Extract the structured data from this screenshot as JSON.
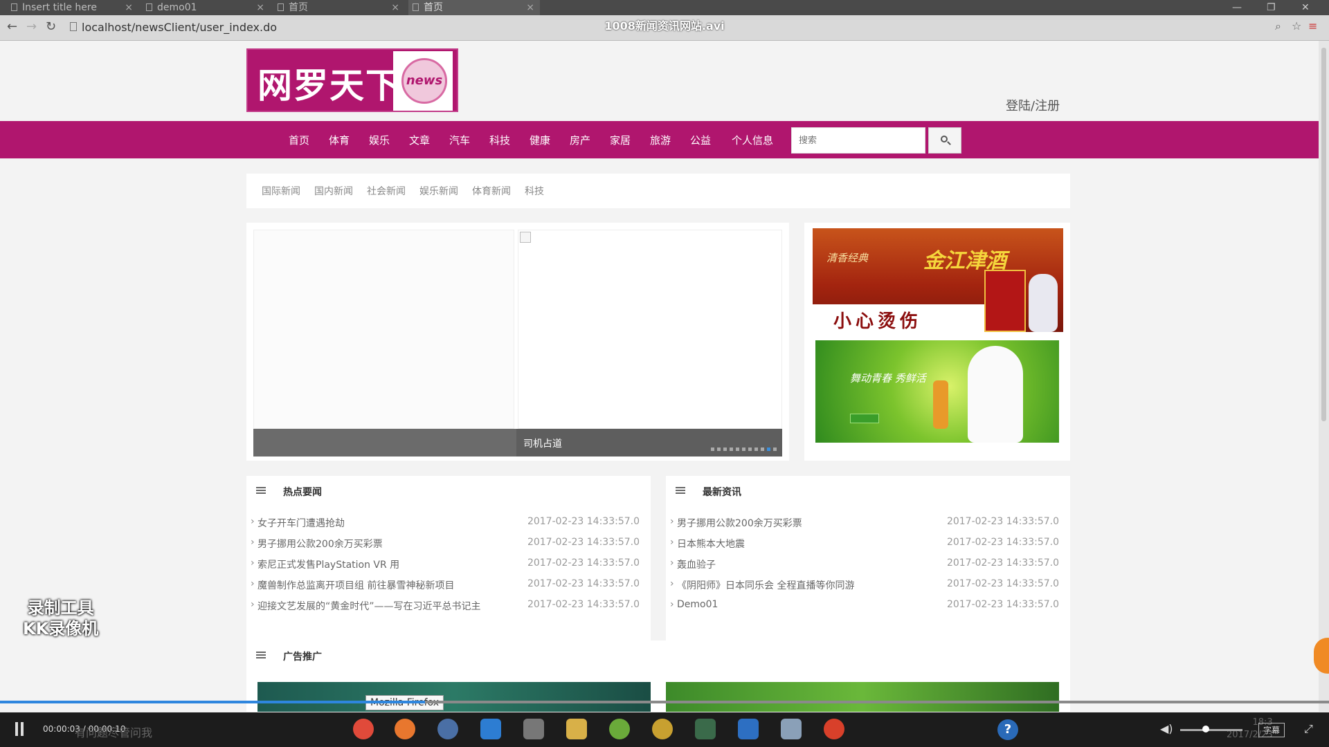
{
  "browser": {
    "tabs": [
      {
        "label": "Insert title here"
      },
      {
        "label": "demo01"
      },
      {
        "label": "首页"
      },
      {
        "label": "首页"
      }
    ],
    "url": "localhost/newsClient/user_index.do",
    "video_title": "1008新闻资讯网站.avi"
  },
  "site": {
    "logo_text": "网罗天下",
    "logo_badge": "news",
    "login_link": "登陆/注册",
    "nav": [
      "首页",
      "体育",
      "娱乐",
      "文章",
      "汽车",
      "科技",
      "健康",
      "房产",
      "家居",
      "旅游",
      "公益",
      "个人信息"
    ],
    "search": {
      "placeholder": "搜索"
    },
    "subnav": [
      "国际新闻",
      "国内新闻",
      "社会新闻",
      "娱乐新闻",
      "体育新闻",
      "科技"
    ],
    "carousel": {
      "caption": "司机占道",
      "dot_count": 11
    },
    "ads": {
      "ad1": {
        "slogan": "清香经典",
        "brand": "金江津酒",
        "banner": "小心烫伤"
      },
      "ad2": {
        "slogan": "舞动青春 秀鲜活"
      }
    },
    "hot_news": {
      "title": "热点要闻",
      "items": [
        {
          "title": "女子开车门遭遇抢劫",
          "time": "2017-02-23 14:33:57.0"
        },
        {
          "title": "男子挪用公款200余万买彩票",
          "time": "2017-02-23 14:33:57.0"
        },
        {
          "title": "索尼正式发售PlayStation VR 用",
          "time": "2017-02-23 14:33:57.0"
        },
        {
          "title": "魔兽制作总监离开项目组 前往暴雪神秘新项目",
          "time": "2017-02-23 14:33:57.0"
        },
        {
          "title": "迎接文艺发展的“黄金时代”——写在习近平总书记主",
          "time": "2017-02-23 14:33:57.0"
        }
      ]
    },
    "latest_news": {
      "title": "最新资讯",
      "items": [
        {
          "title": "男子挪用公款200余万买彩票",
          "time": "2017-02-23 14:33:57.0"
        },
        {
          "title": "日本熊本大地震",
          "time": "2017-02-23 14:33:57.0"
        },
        {
          "title": "轰血验子",
          "time": "2017-02-23 14:33:57.0"
        },
        {
          "title": "《阴阳师》日本同乐会 全程直播等你同游",
          "time": "2017-02-23 14:33:57.0"
        },
        {
          "title": "Demo01",
          "time": "2017-02-23 14:33:57.0"
        }
      ]
    },
    "ad_section": {
      "title": "广告推广"
    }
  },
  "overlay": {
    "watermark_line1": "录制工具",
    "watermark_line2": "KK录像机",
    "firefox_tooltip": "Mozilla Firefox"
  },
  "player": {
    "time": "00:00:03 / 00:00:10",
    "progress_fraction": 0.32,
    "subtitle_btn": "字幕",
    "cortana_placeholder": "有问题尽管问我",
    "clock_time": "18:3",
    "clock_date": "2017/2/23"
  },
  "colors": {
    "brand": "#b0166e",
    "progress": "#2e86de"
  }
}
